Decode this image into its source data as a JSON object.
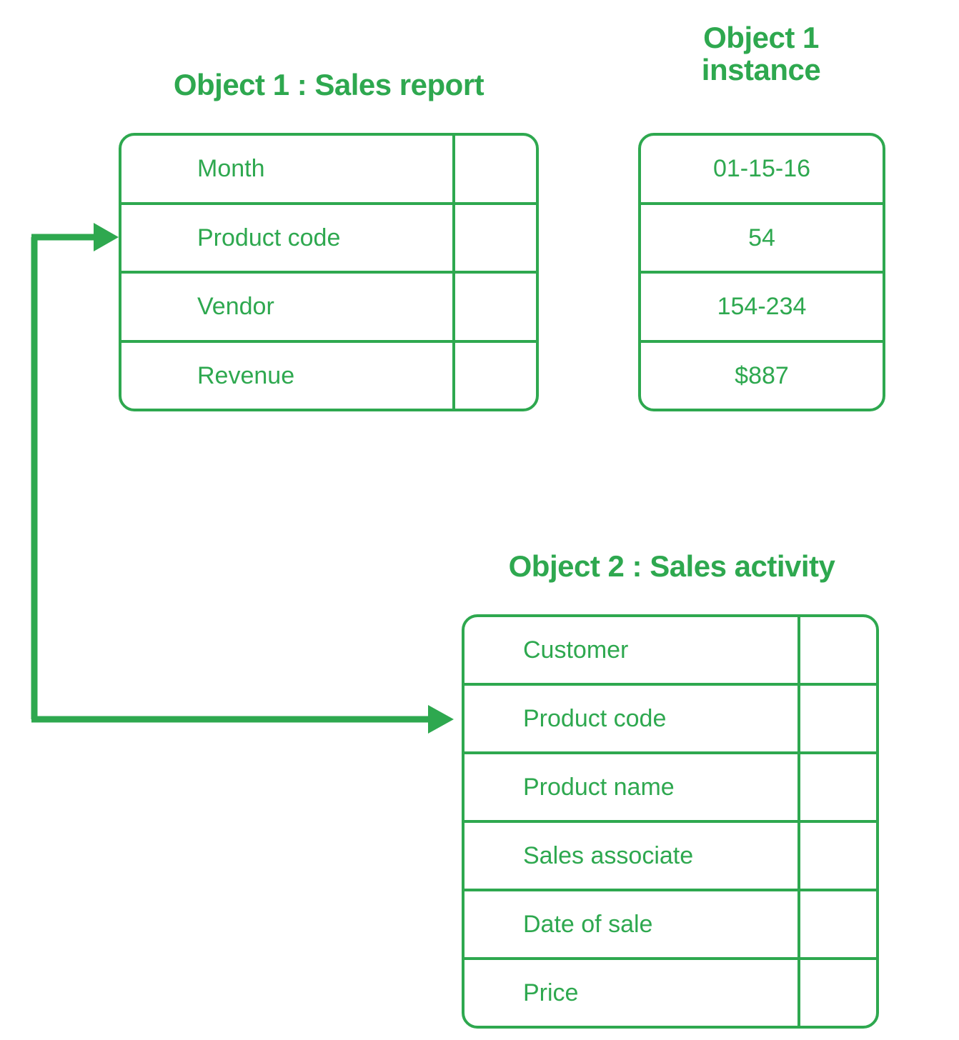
{
  "theme": {
    "accent": "#2ea84f",
    "background": "#ffffff"
  },
  "diagram": {
    "type": "entity-relationship",
    "description": "Two object definition tables linked by a shared Product code field, plus an instance table of example values for Object 1."
  },
  "object1": {
    "title": "Object 1 : Sales report",
    "fields": [
      {
        "label": "Month"
      },
      {
        "label": "Product code"
      },
      {
        "label": "Vendor"
      },
      {
        "label": "Revenue"
      }
    ]
  },
  "instance": {
    "title": "Object 1\ninstance",
    "values": [
      {
        "value": "01-15-16"
      },
      {
        "value": "54"
      },
      {
        "value": "154-234"
      },
      {
        "value": "$887"
      }
    ]
  },
  "object2": {
    "title": "Object 2 : Sales activity",
    "fields": [
      {
        "label": "Customer"
      },
      {
        "label": "Product code"
      },
      {
        "label": "Product name"
      },
      {
        "label": "Sales associate"
      },
      {
        "label": "Date of sale"
      },
      {
        "label": "Price"
      }
    ]
  },
  "connector": {
    "name": "product-code-relationship",
    "from": "Object 1 : Sales report / Product code",
    "to": "Object 2 : Sales activity / Product code",
    "color": "#2ea84f"
  }
}
